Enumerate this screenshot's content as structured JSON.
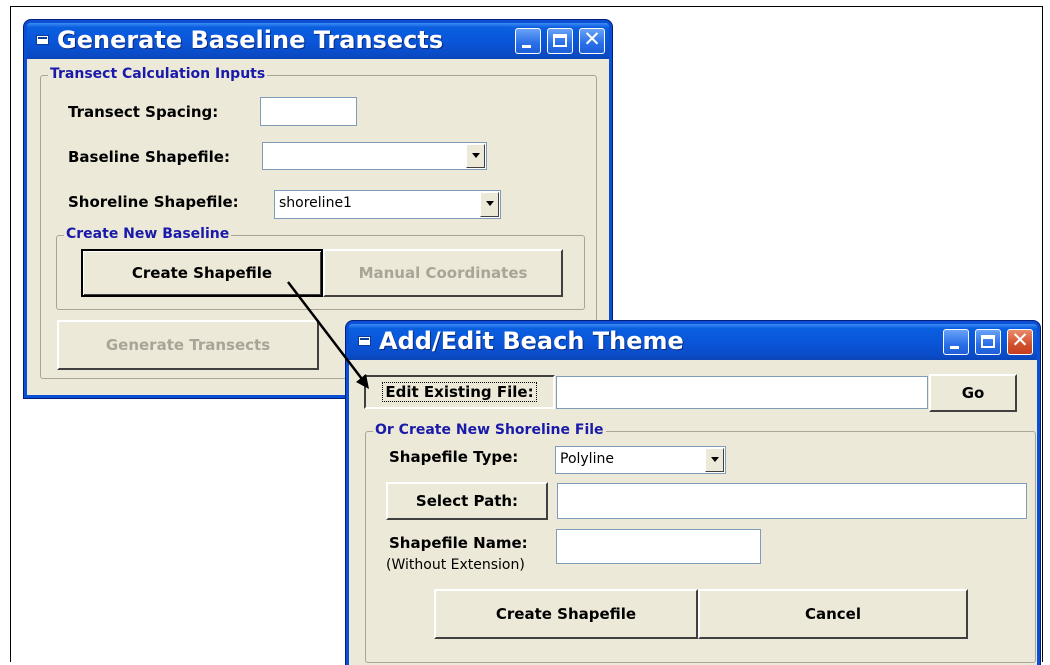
{
  "window1": {
    "title": "Generate Baseline Transects",
    "group_inputs_label": "Transect Calculation Inputs",
    "transect_spacing_label": "Transect Spacing:",
    "transect_spacing_value": "",
    "baseline_shapefile_label": "Baseline Shapefile:",
    "baseline_shapefile_value": "",
    "shoreline_shapefile_label": "Shoreline Shapefile:",
    "shoreline_shapefile_value": "shoreline1",
    "group_baseline_label": "Create New Baseline",
    "create_shapefile_label": "Create Shapefile",
    "manual_coordinates_label": "Manual Coordinates",
    "generate_transects_label": "Generate Transects"
  },
  "window2": {
    "title": "Add/Edit Beach Theme",
    "edit_existing_label": "Edit Existing File:",
    "edit_existing_value": "",
    "go_label": "Go",
    "group_new_label": "Or Create New Shoreline File",
    "shapefile_type_label": "Shapefile Type:",
    "shapefile_type_value": "Polyline",
    "select_path_label": "Select Path:",
    "select_path_value": "",
    "shapefile_name_label": "Shapefile Name:",
    "shapefile_name_note": "(Without Extension)",
    "shapefile_name_value": "",
    "create_shapefile_label": "Create Shapefile",
    "cancel_label": "Cancel"
  },
  "icons": [
    "window-icon",
    "minimize-icon",
    "maximize-icon",
    "close-icon",
    "dropdown-arrow-icon",
    "pointer-arrow"
  ],
  "colors": {
    "titlebar": "#0a54d8",
    "window_bg": "#ece9d8",
    "group_label": "#1a1aaa",
    "close_button": "#d2512c"
  }
}
